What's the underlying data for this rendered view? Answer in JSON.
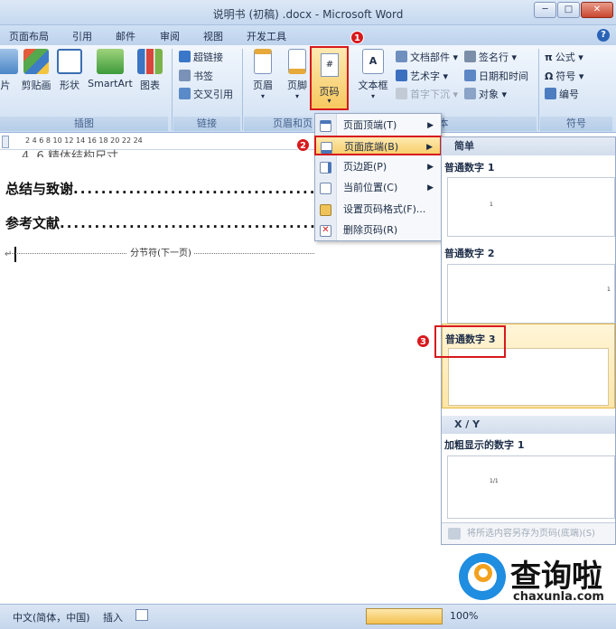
{
  "window": {
    "title": "说明书 (初稿) .docx - Microsoft Word",
    "minimize": "─",
    "maximize": "□",
    "close": "✕"
  },
  "tabs": [
    "页面布局",
    "引用",
    "邮件",
    "审阅",
    "视图",
    "开发工具"
  ],
  "help": "?",
  "ribbon": {
    "illustrations": {
      "label": "插图",
      "buttons": [
        "片",
        "剪贴画",
        "形状",
        "SmartArt",
        "图表"
      ]
    },
    "links": {
      "label": "链接",
      "buttons": [
        "超链接",
        "书签",
        "交叉引用"
      ]
    },
    "header_footer": {
      "label": "页眉和页",
      "buttons": [
        "页眉",
        "页脚",
        "页码"
      ]
    },
    "text": {
      "label": "本",
      "textbox": "文本框",
      "buttons": [
        "文档部件 ▾",
        "艺术字 ▾",
        "首字下沉 ▾",
        "签名行 ▾",
        "日期和时间",
        "对象 ▾"
      ]
    },
    "symbols": {
      "label": "符号",
      "buttons": [
        "公式 ▾",
        "符号 ▾",
        "编号"
      ]
    }
  },
  "badges": [
    "1",
    "2",
    "3"
  ],
  "ruler_numbers": "2    4    6    8   10   12   14   16   18   20   22   24",
  "document": {
    "partial_line": "4. 6 精体结构尺寸",
    "toc": [
      {
        "title": "总结与致谢",
        "dots": "..........................................."
      },
      {
        "title": "参考文献",
        "dots": "..........................................."
      }
    ],
    "arrow_mark": "→",
    "para_mark": "↵",
    "section_break": "分节符(下一页)"
  },
  "menu": {
    "items": [
      {
        "label": "页面顶端(T)",
        "submenu": true
      },
      {
        "label": "页面底端(B)",
        "submenu": true
      },
      {
        "label": "页边距(P)",
        "submenu": true
      },
      {
        "label": "当前位置(C)",
        "submenu": true
      },
      {
        "label": "设置页码格式(F)...",
        "submenu": false
      },
      {
        "label": "删除页码(R)",
        "submenu": false
      }
    ],
    "arrow": "▶"
  },
  "gallery": {
    "section_simple": "简单",
    "items": [
      {
        "title": "普通数字 1",
        "sample": "1"
      },
      {
        "title": "普通数字 2",
        "sample": "1"
      },
      {
        "title": "普通数字 3",
        "sample": ""
      }
    ],
    "section_xy": "X / Y",
    "bold_item": {
      "title": "加粗显示的数字 1",
      "sample": "1/1"
    },
    "footer": "将所选内容另存为页码(底端)(S)"
  },
  "statusbar": {
    "language": "中文(简体，中国)",
    "insert": "插入",
    "zoom": "100%"
  },
  "watermark": {
    "text": "查询啦",
    "url": "chaxunla.com"
  },
  "colors": {
    "highlight_red": "#d7191c",
    "ribbon_blue": "#dbe7f6",
    "menu_hover": "#f8cf6c"
  }
}
